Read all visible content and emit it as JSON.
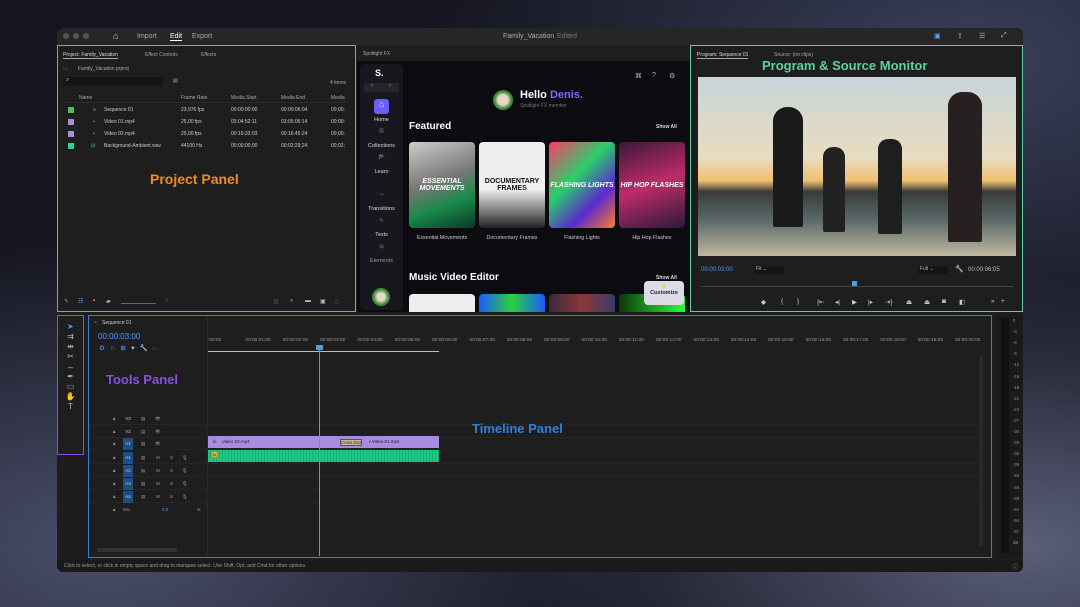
{
  "window": {
    "title": "Family_Vacation",
    "status": "Edited",
    "menu": [
      "Import",
      "Edit",
      "Export"
    ],
    "active_menu": "Edit"
  },
  "project": {
    "tabs": [
      "Project: Family_Vacation",
      "Effect Controls",
      "Effects"
    ],
    "file": "Family_Vacation.prproj",
    "count": "4 items",
    "annotation": "Project Panel",
    "columns": [
      "Name",
      "Frame Rate",
      "Media Start",
      "Media End",
      "Media"
    ],
    "rows": [
      {
        "color": "#4cbf57",
        "name": "Sequence 01",
        "rate": "23,976 fps",
        "start": "00:00:00:00",
        "end": "00:00:06:04",
        "media": "00:00:"
      },
      {
        "color": "#a98be0",
        "name": "Video 01.mp4",
        "rate": "25,00 fps",
        "start": "03:04:52:11",
        "end": "03:05:06:14",
        "media": "00:00:"
      },
      {
        "color": "#a98be0",
        "name": "Video 02.mp4",
        "rate": "25,00 fps",
        "start": "00:16:33:03",
        "end": "00:16:45:24",
        "media": "00:00:"
      },
      {
        "color": "#2fd38f",
        "name": "Background-Ambient.wav",
        "rate": "44100 Hz",
        "start": "00;00;00;00",
        "end": "00;02;29;24",
        "media": "00;02;"
      }
    ]
  },
  "spotlight": {
    "tab": "Spotlight FX",
    "logo": "S.",
    "greeting": "Hello",
    "user": "Denis.",
    "member": "Spotlight FX member",
    "nav": [
      "Home",
      "Collections",
      "Learn",
      "Transitions",
      "Texts",
      "Elements"
    ],
    "featured": "Featured",
    "show_all": "Show All",
    "music": "Music Video Editor",
    "customize": "Customize",
    "cards": [
      {
        "title": "ESSENTIAL MOVEMENTS",
        "label": "Essential Movements"
      },
      {
        "title": "DOCUMENTARY FRAMES",
        "label": "Documentary Frames"
      },
      {
        "title": "FLASHING LIGHTS",
        "label": "Flashing Lights"
      },
      {
        "title": "HIP HOP FLASHES",
        "label": "Hip Hop Flashes"
      }
    ]
  },
  "monitor": {
    "tabs": [
      "Program: Sequence 01",
      "Source: (no clips)"
    ],
    "annotation": "Program & Source Monitor",
    "time": "00:00:03:00",
    "fit": "Fit",
    "quality": "Full",
    "duration": "00:00:06:05",
    "playhead_fraction": 0.49
  },
  "tools": {
    "annotation": "Tools Panel"
  },
  "timeline": {
    "tab": "Sequence 01",
    "time": "00:00:03:00",
    "annotation": "Timeline Panel",
    "ruler": [
      ":00:00",
      "00:00:01:00",
      "00:00:02:00",
      "00:00:03:00",
      "00:00:04:00",
      "00:00:05:00",
      "00:00:06:00",
      "00:00:07:00",
      "00:00:08:00",
      "00:00:09:00",
      "00:00:10:00",
      "00:00:11:00",
      "00:00:12:00",
      "00:00:13:00",
      "00:00:14:00",
      "00:00:15:00",
      "00:00:16:00",
      "00:00:17:00",
      "00:00:18:00",
      "00:00:19:00",
      "00:00:20:00"
    ],
    "video_tracks": [
      "V3",
      "V2",
      "V1"
    ],
    "audio_tracks": [
      "A1",
      "A2",
      "A3",
      "A4"
    ],
    "mix": "Mix",
    "mix_value": "0,0",
    "m": "M",
    "s": "S",
    "clips": {
      "v1a": "Video 02.mp4",
      "transition": "Cross Diss",
      "v1b": "Video 01.mp4",
      "fx": "fx"
    }
  },
  "meter": {
    "labels": [
      "0",
      "-3",
      "-6",
      "-9",
      "-12",
      "-15",
      "-18",
      "-21",
      "-24",
      "-27",
      "-30",
      "-33",
      "-36",
      "-39",
      "-42",
      "-45",
      "-48",
      "-51",
      "-54",
      "-57",
      "dB"
    ]
  },
  "status": "Click to select, or click in empty space and drag to marquee select. Use Shift, Opt, and Cmd for other options.",
  "colors": {
    "project": "#f08a24",
    "monitor": "#5fcf9f",
    "tools": "#8a4fe0",
    "timeline": "#2f7fe0",
    "accent": "#6b5cff"
  }
}
